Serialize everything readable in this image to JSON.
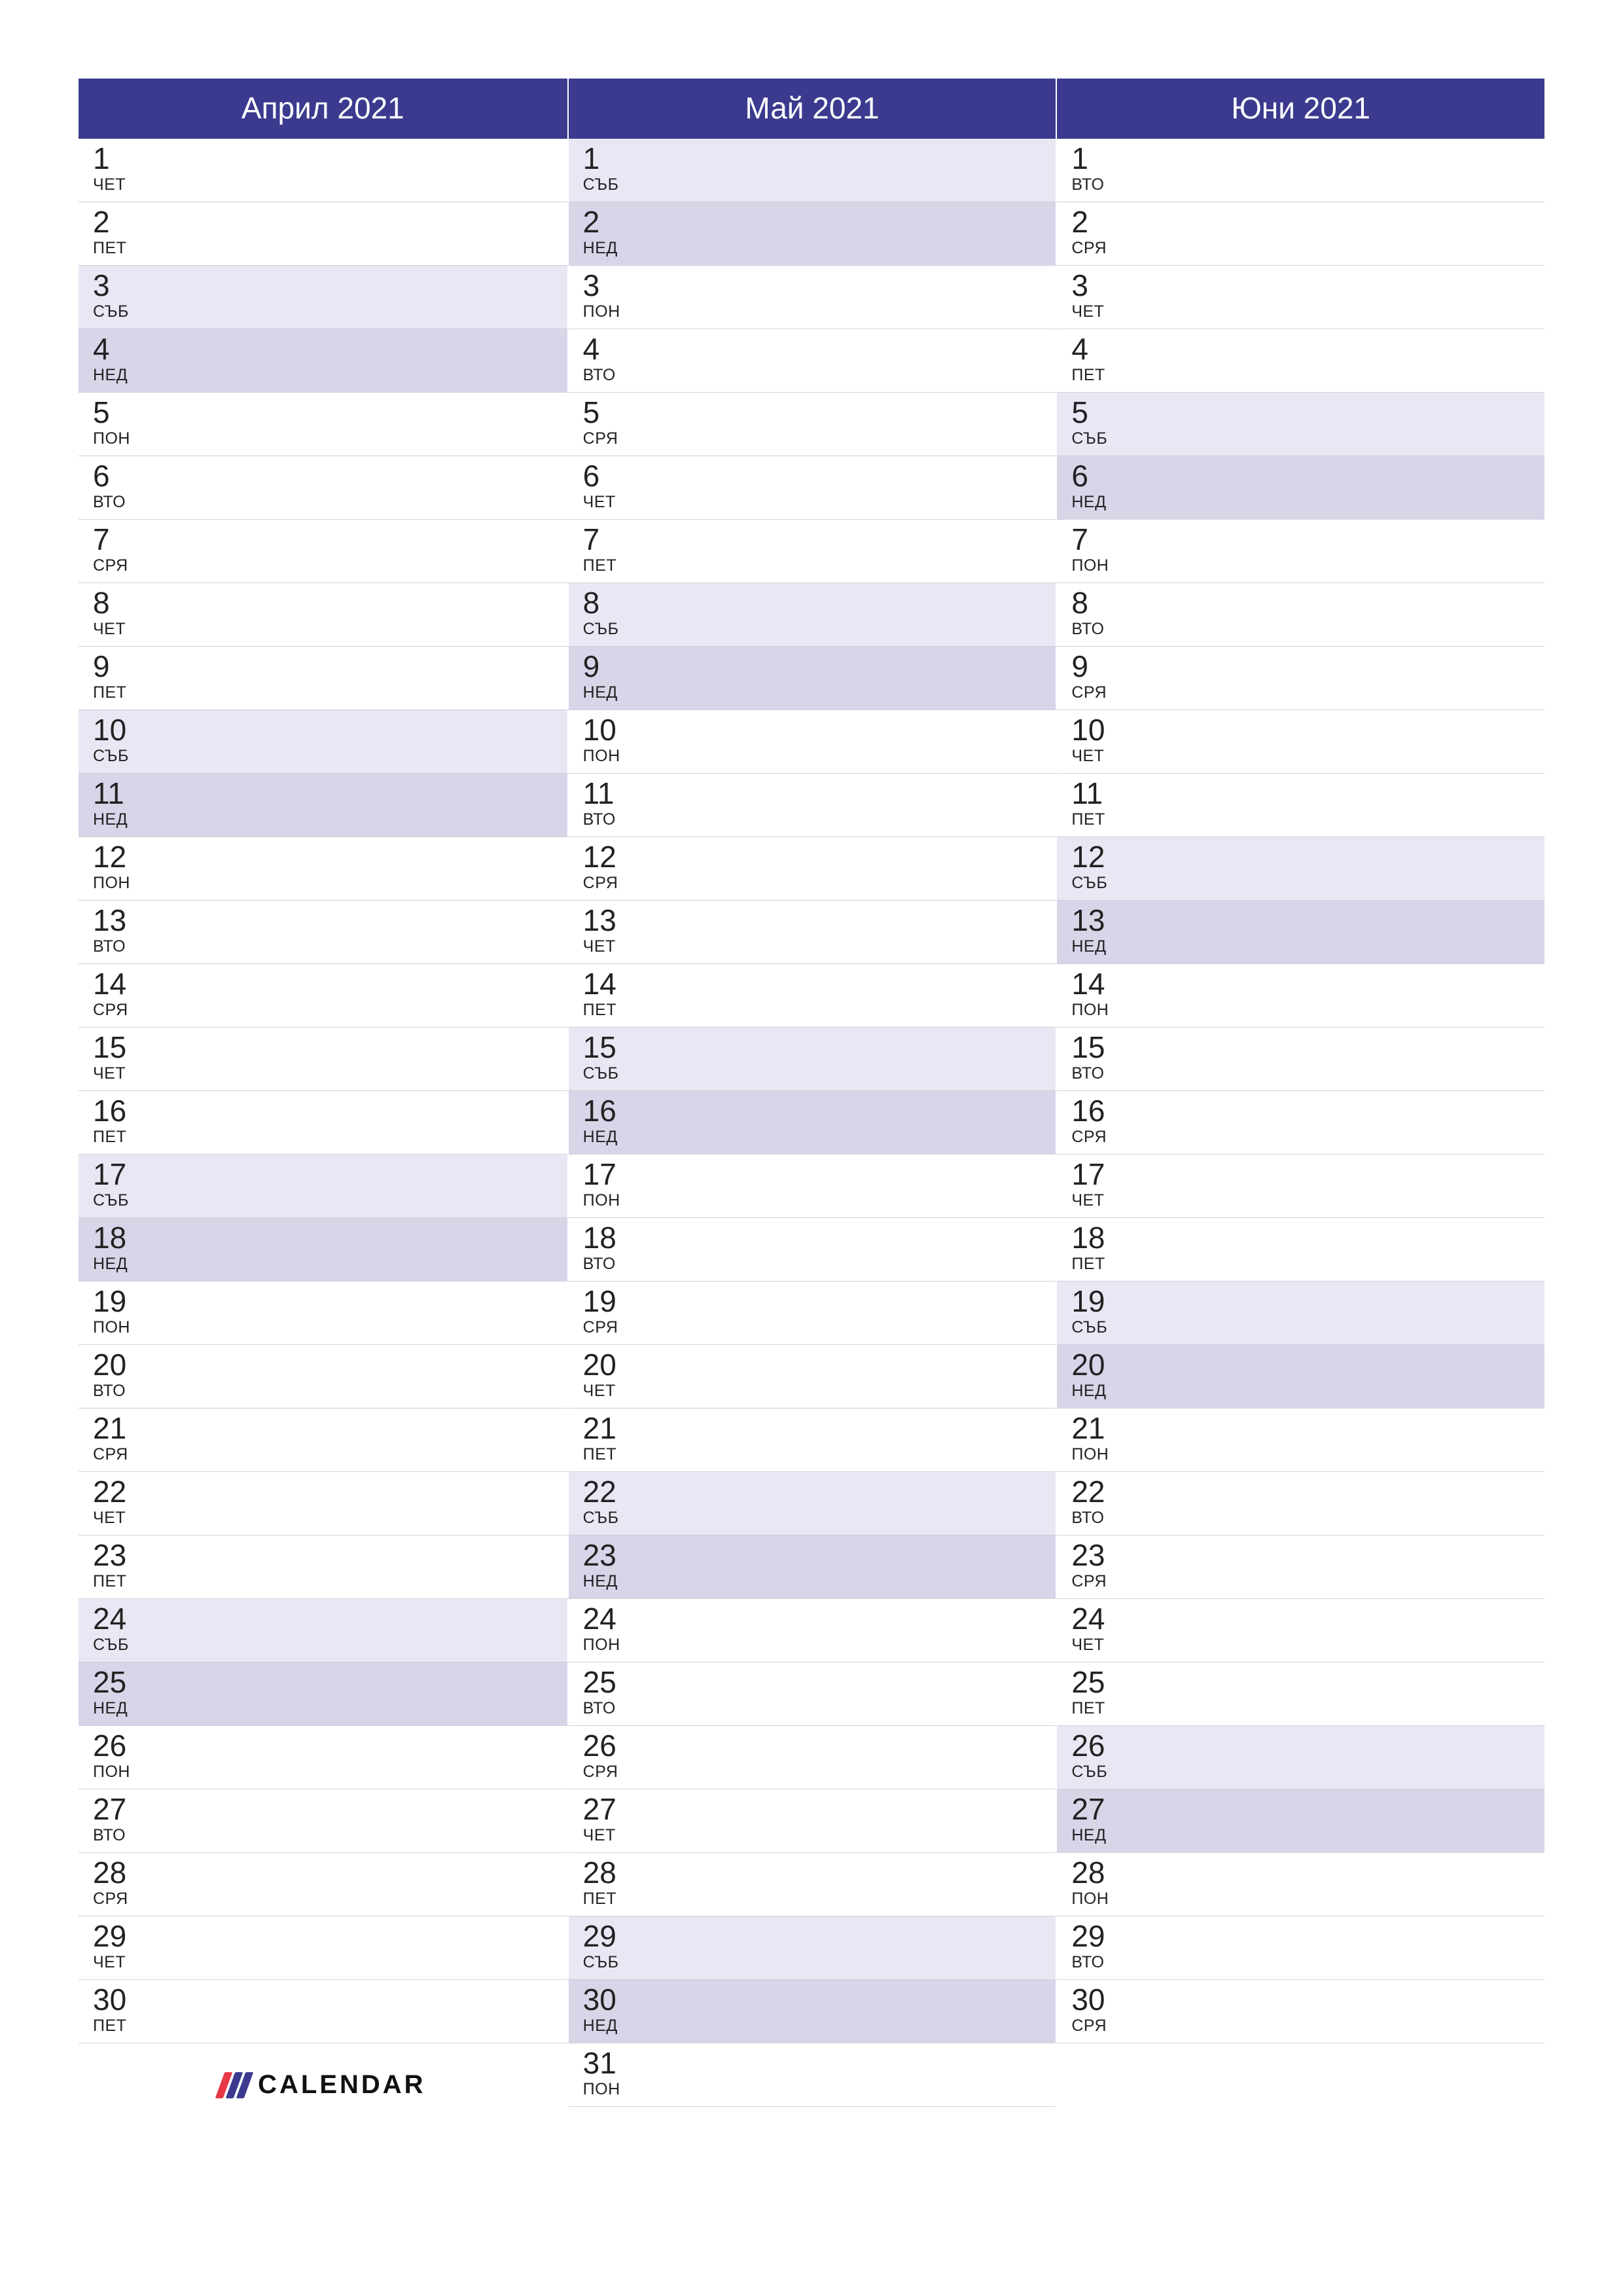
{
  "logo_text": "CALENDAR",
  "day_names": {
    "mon": "ПОН",
    "tue": "ВТО",
    "wed": "СРЯ",
    "thu": "ЧЕТ",
    "fri": "ПЕТ",
    "sat": "СЪБ",
    "sun": "НЕД"
  },
  "months": [
    {
      "title": "Април 2021",
      "days": [
        {
          "n": "1",
          "d": "thu"
        },
        {
          "n": "2",
          "d": "fri"
        },
        {
          "n": "3",
          "d": "sat"
        },
        {
          "n": "4",
          "d": "sun"
        },
        {
          "n": "5",
          "d": "mon"
        },
        {
          "n": "6",
          "d": "tue"
        },
        {
          "n": "7",
          "d": "wed"
        },
        {
          "n": "8",
          "d": "thu"
        },
        {
          "n": "9",
          "d": "fri"
        },
        {
          "n": "10",
          "d": "sat"
        },
        {
          "n": "11",
          "d": "sun"
        },
        {
          "n": "12",
          "d": "mon"
        },
        {
          "n": "13",
          "d": "tue"
        },
        {
          "n": "14",
          "d": "wed"
        },
        {
          "n": "15",
          "d": "thu"
        },
        {
          "n": "16",
          "d": "fri"
        },
        {
          "n": "17",
          "d": "sat"
        },
        {
          "n": "18",
          "d": "sun"
        },
        {
          "n": "19",
          "d": "mon"
        },
        {
          "n": "20",
          "d": "tue"
        },
        {
          "n": "21",
          "d": "wed"
        },
        {
          "n": "22",
          "d": "thu"
        },
        {
          "n": "23",
          "d": "fri"
        },
        {
          "n": "24",
          "d": "sat"
        },
        {
          "n": "25",
          "d": "sun"
        },
        {
          "n": "26",
          "d": "mon"
        },
        {
          "n": "27",
          "d": "tue"
        },
        {
          "n": "28",
          "d": "wed"
        },
        {
          "n": "29",
          "d": "thu"
        },
        {
          "n": "30",
          "d": "fri"
        }
      ]
    },
    {
      "title": "Май 2021",
      "days": [
        {
          "n": "1",
          "d": "sat"
        },
        {
          "n": "2",
          "d": "sun"
        },
        {
          "n": "3",
          "d": "mon"
        },
        {
          "n": "4",
          "d": "tue"
        },
        {
          "n": "5",
          "d": "wed"
        },
        {
          "n": "6",
          "d": "thu"
        },
        {
          "n": "7",
          "d": "fri"
        },
        {
          "n": "8",
          "d": "sat"
        },
        {
          "n": "9",
          "d": "sun"
        },
        {
          "n": "10",
          "d": "mon"
        },
        {
          "n": "11",
          "d": "tue"
        },
        {
          "n": "12",
          "d": "wed"
        },
        {
          "n": "13",
          "d": "thu"
        },
        {
          "n": "14",
          "d": "fri"
        },
        {
          "n": "15",
          "d": "sat"
        },
        {
          "n": "16",
          "d": "sun"
        },
        {
          "n": "17",
          "d": "mon"
        },
        {
          "n": "18",
          "d": "tue"
        },
        {
          "n": "19",
          "d": "wed"
        },
        {
          "n": "20",
          "d": "thu"
        },
        {
          "n": "21",
          "d": "fri"
        },
        {
          "n": "22",
          "d": "sat"
        },
        {
          "n": "23",
          "d": "sun"
        },
        {
          "n": "24",
          "d": "mon"
        },
        {
          "n": "25",
          "d": "tue"
        },
        {
          "n": "26",
          "d": "wed"
        },
        {
          "n": "27",
          "d": "thu"
        },
        {
          "n": "28",
          "d": "fri"
        },
        {
          "n": "29",
          "d": "sat"
        },
        {
          "n": "30",
          "d": "sun"
        },
        {
          "n": "31",
          "d": "mon"
        }
      ]
    },
    {
      "title": "Юни 2021",
      "days": [
        {
          "n": "1",
          "d": "tue"
        },
        {
          "n": "2",
          "d": "wed"
        },
        {
          "n": "3",
          "d": "thu"
        },
        {
          "n": "4",
          "d": "fri"
        },
        {
          "n": "5",
          "d": "sat"
        },
        {
          "n": "6",
          "d": "sun"
        },
        {
          "n": "7",
          "d": "mon"
        },
        {
          "n": "8",
          "d": "tue"
        },
        {
          "n": "9",
          "d": "wed"
        },
        {
          "n": "10",
          "d": "thu"
        },
        {
          "n": "11",
          "d": "fri"
        },
        {
          "n": "12",
          "d": "sat"
        },
        {
          "n": "13",
          "d": "sun"
        },
        {
          "n": "14",
          "d": "mon"
        },
        {
          "n": "15",
          "d": "tue"
        },
        {
          "n": "16",
          "d": "wed"
        },
        {
          "n": "17",
          "d": "thu"
        },
        {
          "n": "18",
          "d": "fri"
        },
        {
          "n": "19",
          "d": "sat"
        },
        {
          "n": "20",
          "d": "sun"
        },
        {
          "n": "21",
          "d": "mon"
        },
        {
          "n": "22",
          "d": "tue"
        },
        {
          "n": "23",
          "d": "wed"
        },
        {
          "n": "24",
          "d": "thu"
        },
        {
          "n": "25",
          "d": "fri"
        },
        {
          "n": "26",
          "d": "sat"
        },
        {
          "n": "27",
          "d": "sun"
        },
        {
          "n": "28",
          "d": "mon"
        },
        {
          "n": "29",
          "d": "tue"
        },
        {
          "n": "30",
          "d": "wed"
        }
      ]
    }
  ]
}
